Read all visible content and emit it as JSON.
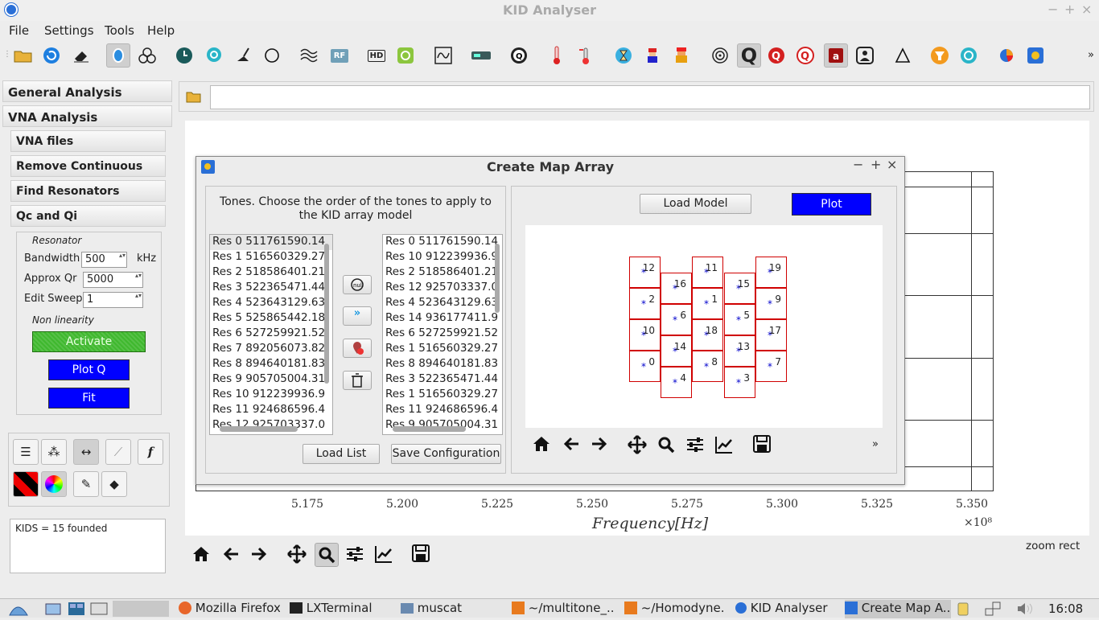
{
  "window": {
    "title": "KID Analyser",
    "min": "−",
    "max": "+",
    "close": "×"
  },
  "menu": [
    "File",
    "Settings",
    "Tools",
    "Help"
  ],
  "toolbar": {
    "rf_label": "RF",
    "hd_label": "HD",
    "overflow": "»",
    "icons": [
      "open-folder-icon",
      "refresh-icon",
      "eraser-icon",
      "shield-icon",
      "cluster-icon",
      "clock-icon",
      "search-globe-icon",
      "broom-icon",
      "circle-icon",
      "wave-hand-icon",
      "rf-icon",
      "hd-icon",
      "iq-icon",
      "sine-icon",
      "device-icon",
      "q-circle-icon",
      "thermometer-icon",
      "temperature-icon",
      "hourglass-icon",
      "mario-icon",
      "character-icon",
      "target-icon",
      "q-icon",
      "q-red-icon",
      "q-red-outline-icon",
      "a-icon",
      "person-icon",
      "triangle-icon",
      "funnel-icon",
      "cycle-icon",
      "pie-icon",
      "app-icon"
    ]
  },
  "sidebar": {
    "general": "General Analysis",
    "vna": "VNA Analysis",
    "items": [
      "VNA files",
      "Remove Continuous",
      "Find Resonators",
      "Qc and Qi"
    ],
    "resonator_title": "Resonator",
    "bandwidth_label": "Bandwidth",
    "bandwidth_value": "500",
    "bandwidth_unit": "kHz",
    "approx_qr_label": "Approx Qr",
    "approx_qr_value": "5000",
    "edit_sweep_label": "Edit Sweep",
    "edit_sweep_value": "1",
    "nonlinearity_label": "Non linearity",
    "activate": "Activate",
    "plot_q": "Plot Q",
    "fit": "Fit",
    "status": "KIDS = 15 founded"
  },
  "plot": {
    "x_ticks": [
      "5.175",
      "5.200",
      "5.225",
      "5.250",
      "5.275",
      "5.300",
      "5.325",
      "5.350"
    ],
    "xlabel": "Frequency[Hz]",
    "exponent": "×10⁸",
    "status": "zoom rect"
  },
  "dialog": {
    "title": "Create Map Array",
    "instructions": "Tones. Choose the order of the tones to apply to the KID array model",
    "left_list": [
      "Res 0 511761590.14",
      "Res 1 516560329.27",
      "Res 2 518586401.21",
      "Res 3 522365471.44",
      "Res 4 523643129.63",
      "Res 5 525865442.18",
      "Res 6 527259921.52",
      "Res 7 892056073.82",
      "Res 8 894640181.83",
      "Res 9 905705004.31",
      "Res 10 912239936.9",
      "Res 11 924686596.4",
      "Res 12 925703337.0"
    ],
    "right_list": [
      "Res 0 511761590.14",
      "Res 10 912239936.9",
      "Res 2 518586401.21",
      "Res 12 925703337.0",
      "Res 4 523643129.63",
      "Res 14 936177411.9",
      "Res 6 527259921.52",
      "Res 1 516560329.27",
      "Res 8 894640181.83",
      "Res 3 522365471.44",
      "Res 1 516560329.27",
      "Res 11 924686596.4",
      "Res 9 905705004.31"
    ],
    "load_list": "Load List",
    "save_config": "Save Configuration",
    "load_model": "Load Model",
    "plot": "Plot",
    "more": "»",
    "map_cells": [
      "12",
      "2",
      "10",
      "0",
      "16",
      "6",
      "14",
      "4",
      "11",
      "1",
      "18",
      "8",
      "15",
      "5",
      "13",
      "3",
      "19",
      "9",
      "17",
      "7"
    ]
  },
  "taskbar": {
    "tasks": [
      "Mozilla Firefox",
      "LXTerminal",
      "muscat",
      "~/multitone_...",
      "~/Homodyne...",
      "KID Analyser",
      "Create Map A..."
    ],
    "clock": "16:08"
  }
}
